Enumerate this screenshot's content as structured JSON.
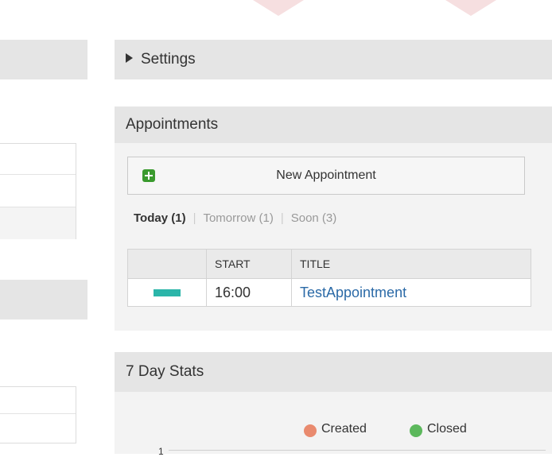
{
  "settings": {
    "label": "Settings"
  },
  "appointments": {
    "title": "Appointments",
    "new_button_label": "New Appointment",
    "tabs": [
      {
        "label": "Today (1)",
        "active": true
      },
      {
        "label": "Tomorrow (1)",
        "active": false
      },
      {
        "label": "Soon (3)",
        "active": false
      }
    ],
    "table": {
      "headers": [
        "",
        "START",
        "TITLE"
      ],
      "rows": [
        {
          "color": "#2bb5a9",
          "start": "16:00",
          "title": "TestAppointment"
        }
      ]
    }
  },
  "stats": {
    "title": "7 Day Stats",
    "legend": [
      {
        "label": "Created",
        "color": "#e98a6e"
      },
      {
        "label": "Closed",
        "color": "#5cb85c"
      }
    ],
    "y_tick": "1"
  },
  "icons": [
    "plus-icon",
    "triangle-right-icon",
    "filter-icon"
  ]
}
